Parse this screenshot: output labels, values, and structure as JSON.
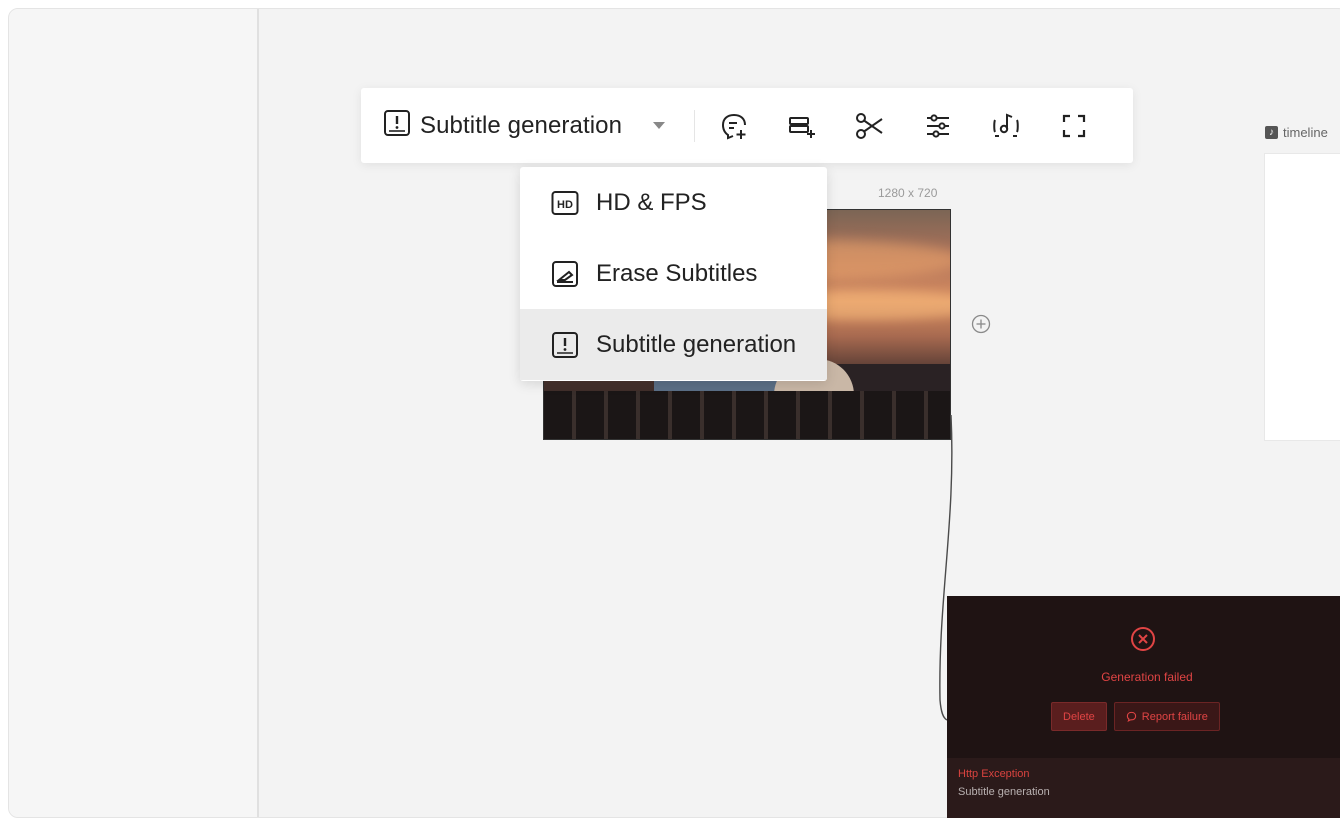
{
  "toolbar": {
    "mode_label": "Subtitle generation",
    "buttons": [
      {
        "name": "add-subtitle-button",
        "icon": "chat-plus-icon"
      },
      {
        "name": "add-track-button",
        "icon": "track-plus-icon"
      },
      {
        "name": "cut-button",
        "icon": "scissors-icon"
      },
      {
        "name": "adjust-button",
        "icon": "sliders-icon"
      },
      {
        "name": "audio-detach-button",
        "icon": "music-note-icon"
      },
      {
        "name": "fullscreen-button",
        "icon": "expand-icon"
      }
    ]
  },
  "dropdown": {
    "items": [
      {
        "label": "HD & FPS",
        "icon": "hd-icon",
        "selected": false
      },
      {
        "label": "Erase Subtitles",
        "icon": "erase-subtitle-icon",
        "selected": false
      },
      {
        "label": "Subtitle generation",
        "icon": "subtitle-generation-icon",
        "selected": true
      }
    ]
  },
  "video_node": {
    "resolution": "1280 x 720"
  },
  "timeline": {
    "label": "timeline"
  },
  "error_panel": {
    "title": "Generation failed",
    "delete_label": "Delete",
    "report_label": "Report failure",
    "exception": "Http Exception",
    "task": "Subtitle generation"
  },
  "colors": {
    "error": "#e04444",
    "error_bg": "#1f1313",
    "canvas_bg": "#f3f3f3"
  }
}
